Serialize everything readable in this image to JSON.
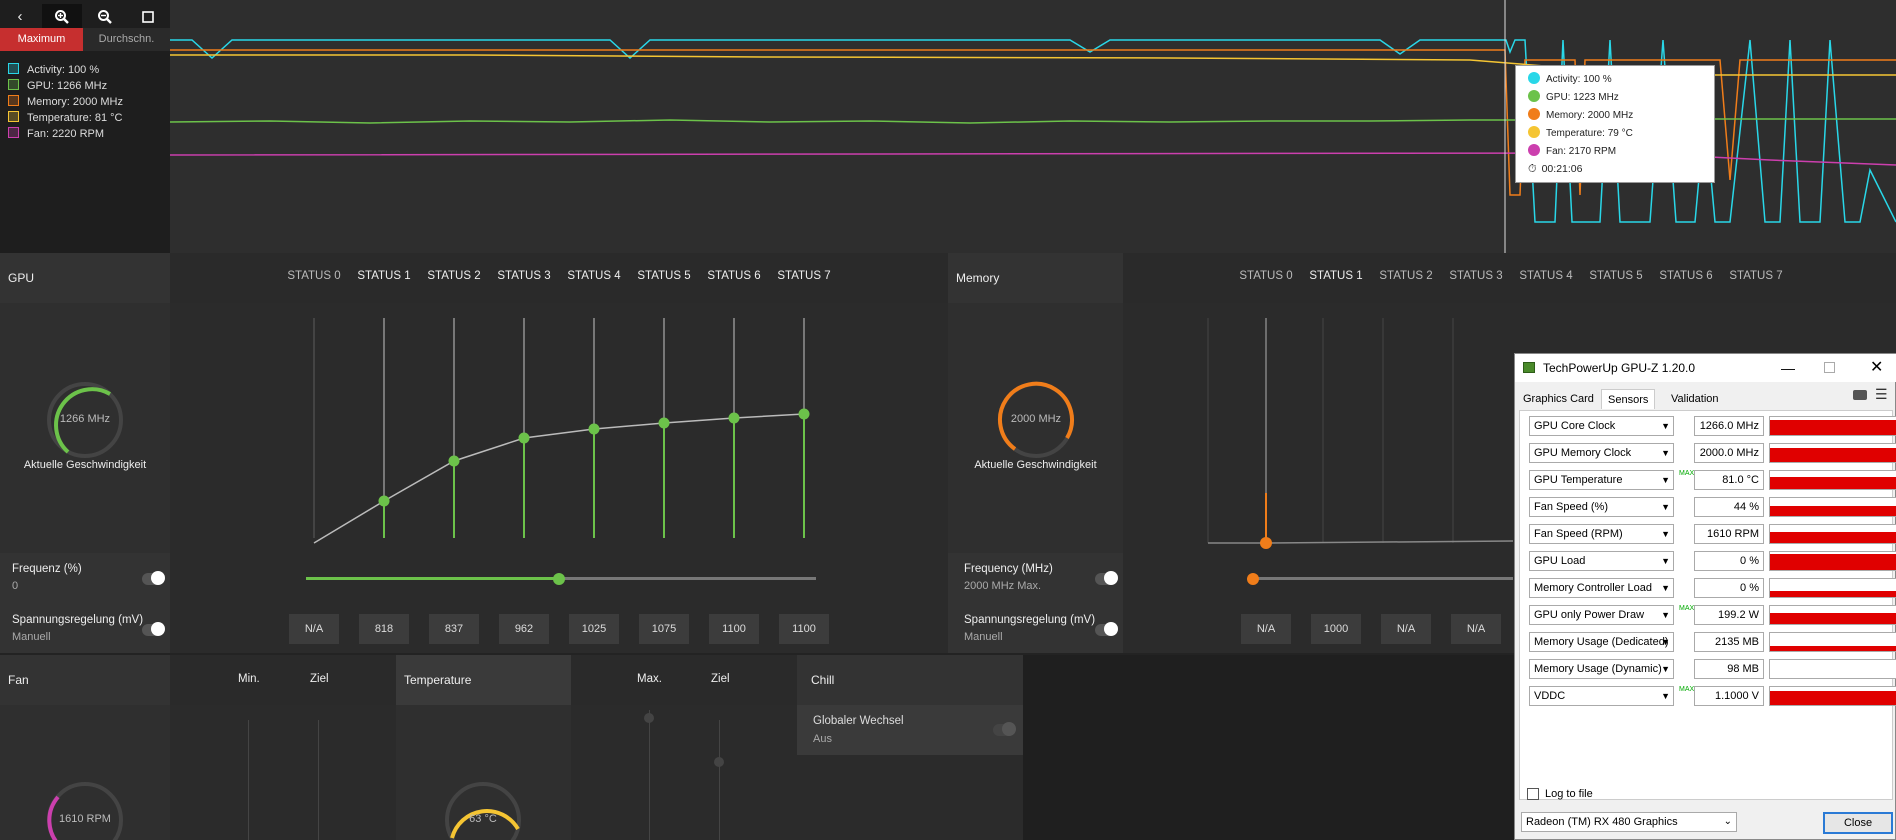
{
  "toolbar": {
    "back_icon": "chevron-left-icon",
    "zoom_in_icon": "zoom-in-icon",
    "zoom_out_icon": "zoom-out-icon",
    "fit_icon": "fit-icon",
    "tab_max": "Maximum",
    "tab_avg": "Durchschn."
  },
  "legend": [
    {
      "label": "Activity: 100 %",
      "color": "#29d7e8"
    },
    {
      "label": "GPU: 1266 MHz",
      "color": "#6cc24a"
    },
    {
      "label": "Memory: 2000 MHz",
      "color": "#f07d1a"
    },
    {
      "label": "Temperature: 81 °C",
      "color": "#f5c533"
    },
    {
      "label": "Fan: 2220 RPM",
      "color": "#cc3fae"
    }
  ],
  "tooltip": {
    "rows": [
      {
        "label": "Activity: 100 %",
        "color": "#29d7e8"
      },
      {
        "label": "GPU: 1223 MHz",
        "color": "#6cc24a"
      },
      {
        "label": "Memory: 2000 MHz",
        "color": "#f07d1a"
      },
      {
        "label": "Temperature: 79 °C",
        "color": "#f5c533"
      },
      {
        "label": "Fan: 2170 RPM",
        "color": "#cc3fae"
      }
    ],
    "time": "00:21:06"
  },
  "gpu": {
    "title": "GPU",
    "statuses": [
      "STATUS 0",
      "STATUS 1",
      "STATUS 2",
      "STATUS 3",
      "STATUS 4",
      "STATUS 5",
      "STATUS 6",
      "STATUS 7"
    ],
    "gauge_value": "1266 MHz",
    "gauge_caption": "Aktuelle Geschwindigkeit",
    "freq_label": "Frequenz (%)",
    "freq_value": "0",
    "volt_label": "Spannungsregelung (mV)",
    "volt_mode": "Manuell",
    "volt_values": [
      "N/A",
      "818",
      "837",
      "962",
      "1025",
      "1075",
      "1100",
      "1100"
    ]
  },
  "memory": {
    "title": "Memory",
    "statuses": [
      "STATUS 0",
      "STATUS 1",
      "STATUS 2",
      "STATUS 3",
      "STATUS 4",
      "STATUS 5",
      "STATUS 6",
      "STATUS 7"
    ],
    "gauge_value": "2000 MHz",
    "gauge_caption": "Aktuelle Geschwindigkeit",
    "freq_label": "Frequency (MHz)",
    "freq_value": "2000 MHz Max.",
    "volt_label": "Spannungsregelung (mV)",
    "volt_mode": "Manuell",
    "volt_values": [
      "N/A",
      "1000",
      "N/A",
      "N/A"
    ]
  },
  "fan": {
    "title": "Fan",
    "min": "Min.",
    "target": "Ziel",
    "gauge_value": "1610 RPM"
  },
  "temperature": {
    "title": "Temperature",
    "max": "Max.",
    "target": "Ziel",
    "gauge_value": "63 °C"
  },
  "chill": {
    "title": "Chill",
    "global_label": "Globaler Wechsel",
    "global_value": "Aus"
  },
  "gpuz": {
    "title": "TechPowerUp GPU-Z 1.20.0",
    "tabs": [
      "Graphics Card",
      "Sensors",
      "Validation"
    ],
    "sensors": [
      {
        "name": "GPU Core Clock",
        "value": "1266.0 MHz",
        "max": ""
      },
      {
        "name": "GPU Memory Clock",
        "value": "2000.0 MHz",
        "max": ""
      },
      {
        "name": "GPU Temperature",
        "value": "81.0 °C",
        "max": "MAX"
      },
      {
        "name": "Fan Speed (%)",
        "value": "44 %",
        "max": ""
      },
      {
        "name": "Fan Speed (RPM)",
        "value": "1610 RPM",
        "max": ""
      },
      {
        "name": "GPU Load",
        "value": "0 %",
        "max": ""
      },
      {
        "name": "Memory Controller Load",
        "value": "0 %",
        "max": ""
      },
      {
        "name": "GPU only Power Draw",
        "value": "199.2 W",
        "max": "MAX"
      },
      {
        "name": "Memory Usage (Dedicated)",
        "value": "2135 MB",
        "max": ""
      },
      {
        "name": "Memory Usage (Dynamic)",
        "value": "98 MB",
        "max": ""
      },
      {
        "name": "VDDC",
        "value": "1.1000 V",
        "max": "MAX"
      }
    ],
    "log_label": "Log to file",
    "device": "Radeon (TM) RX 480 Graphics",
    "close": "Close"
  }
}
